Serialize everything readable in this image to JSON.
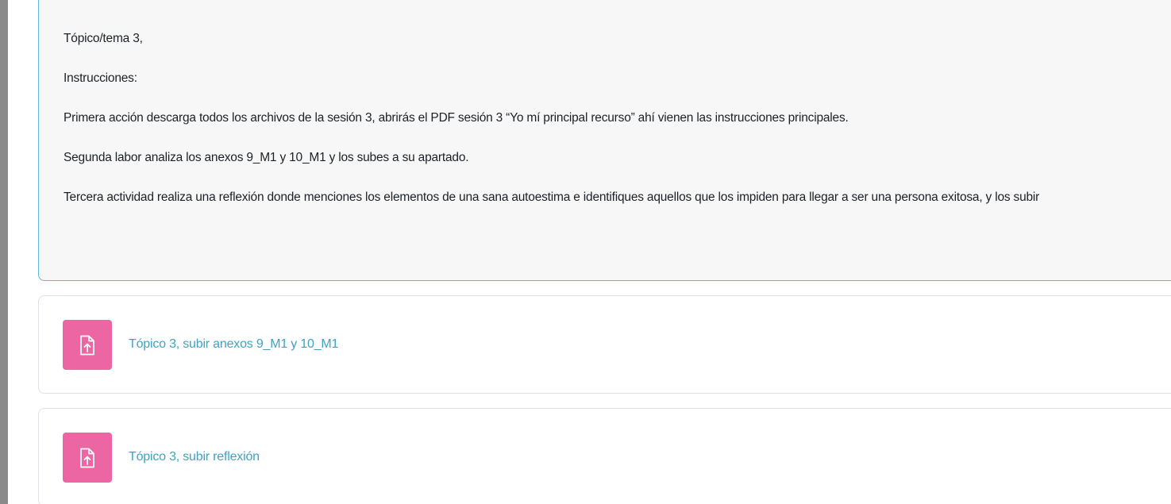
{
  "summary": {
    "paragraphs": [
      "Tópico/tema 3,",
      "Instrucciones:",
      "Primera acción descarga todos los archivos de la sesión 3, abrirás el PDF sesión 3 “Yo mí principal recurso” ahí vienen las instrucciones principales.",
      "Segunda labor analiza los anexos 9_M1 y 10_M1 y los subes a su apartado.",
      "Tercera actividad realiza una reflexión donde menciones los elementos de una sana autoestima e identifiques aquellos que los impiden para llegar a ser una persona exitosa, y los subir"
    ]
  },
  "activities": [
    {
      "icon": "file-upload-icon",
      "label": "Tópico 3, subir anexos 9_M1 y 10_M1"
    },
    {
      "icon": "file-upload-icon",
      "label": "Tópico 3, subir reflexión"
    }
  ],
  "colors": {
    "accent_link": "#3fa2c4",
    "icon_bg": "#eb66a2",
    "card_border": "#5bb8d6",
    "sidebar_gray": "#8a8a8a"
  }
}
